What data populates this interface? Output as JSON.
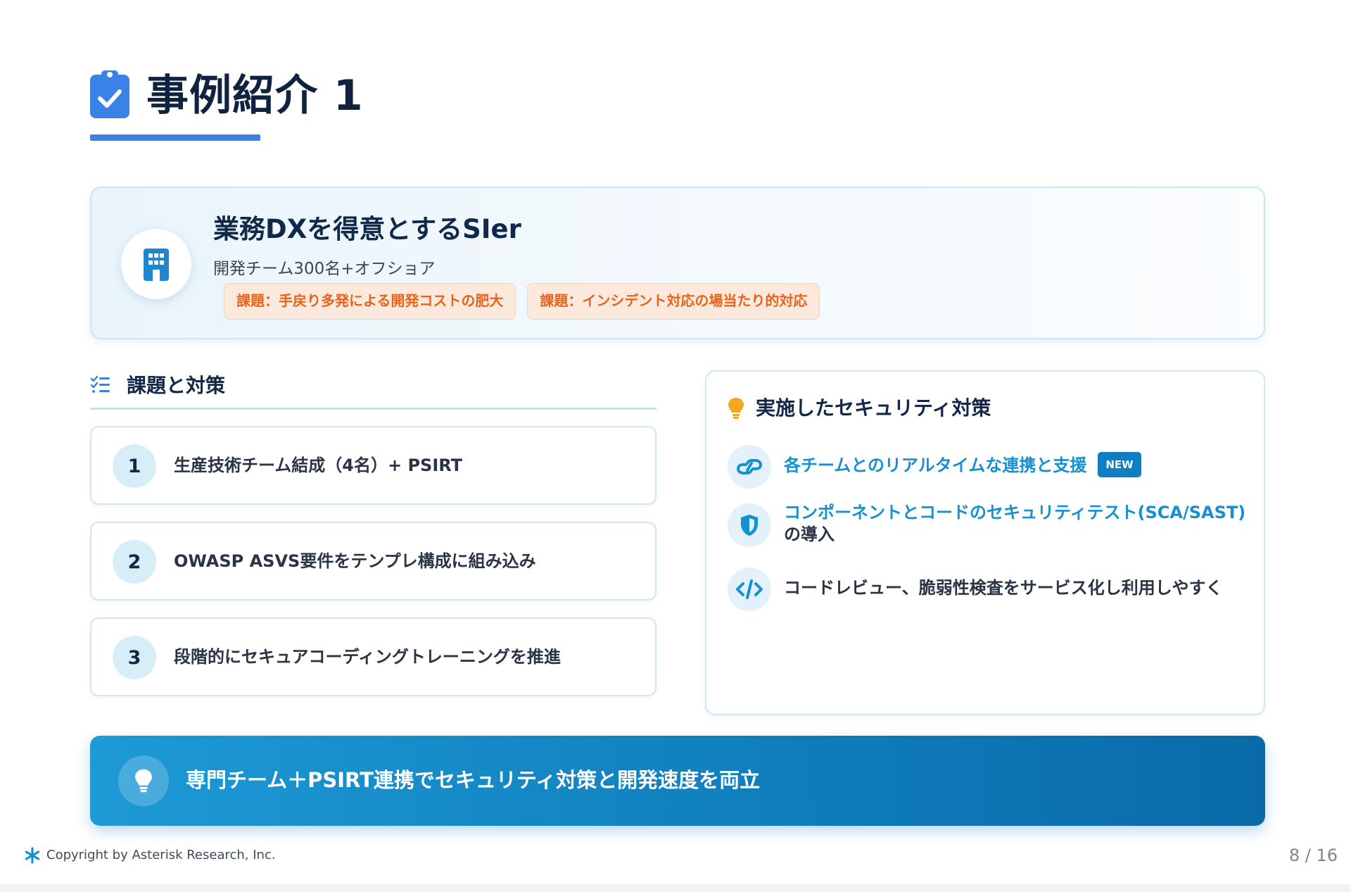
{
  "title": "事例紹介 1",
  "case": {
    "company": "業務DXを得意とするSIer",
    "description": "開発チーム300名+オフショア",
    "tags": [
      "課題：手戻り多発による開発コストの肥大",
      "課題：インシデント対応の場当たり的対応"
    ]
  },
  "challenges": {
    "heading": "課題と対策",
    "steps": [
      {
        "number": "1",
        "text": "生産技術チーム結成（4名）+ PSIRT"
      },
      {
        "number": "2",
        "text": "OWASP ASVS要件をテンプレ構成に組み込み"
      },
      {
        "number": "3",
        "text": "段階的にセキュアコーディングトレーニングを推進"
      }
    ]
  },
  "measures": {
    "heading": "実施したセキュリティ対策",
    "items": [
      {
        "icon": "link-icon",
        "text": "各チームとのリアルタイムな連携と支援",
        "badge": "NEW"
      },
      {
        "icon": "shield-icon",
        "text": "コンポーネントとコードのセキュリティテスト(SCA/SAST)",
        "text_suffix": "の導入"
      },
      {
        "icon": "code-icon",
        "text": "コードレビュー、脆弱性検査をサービス化し利用しやすく"
      }
    ]
  },
  "conclusion": "専門チーム＋PSIRT連携でセキュリティ対策と開発速度を両立",
  "footer": {
    "copyright": "Copyright by Asterisk Research, Inc.",
    "page": "8 / 16"
  },
  "colors": {
    "accent": "#3b82e6",
    "link_blue": "#1690cf",
    "tag_orange": "#e8641c",
    "banner": "#1182c0",
    "badge": "#0f7fc4"
  }
}
